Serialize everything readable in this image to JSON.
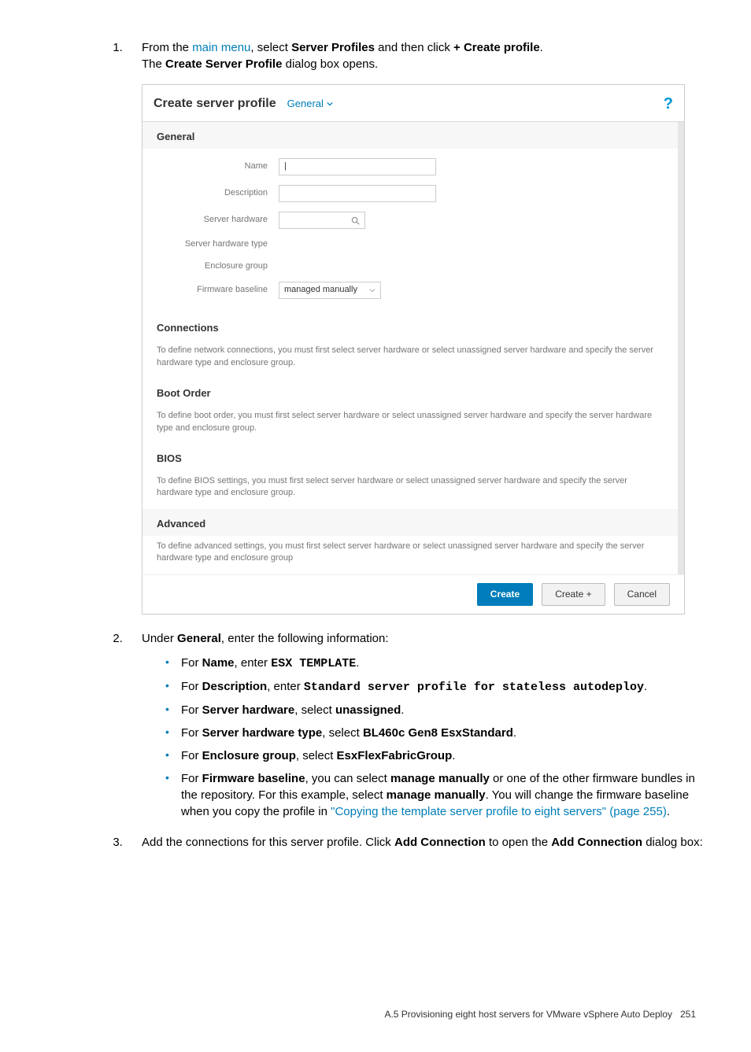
{
  "step1": {
    "pre": "From the ",
    "link": "main menu",
    "mid1": ", select ",
    "bold1": "Server Profiles",
    "mid2": " and then click ",
    "bold2": "+ Create profile",
    "end": ".",
    "line2_pre": "The ",
    "line2_bold": "Create Server Profile",
    "line2_post": " dialog box opens."
  },
  "dialog": {
    "title": "Create server profile",
    "tab": "General",
    "help": "?",
    "sections": {
      "general": {
        "title": "General",
        "labels": {
          "name": "Name",
          "description": "Description",
          "server_hardware": "Server hardware",
          "server_hardware_type": "Server hardware type",
          "enclosure_group": "Enclosure group",
          "firmware_baseline": "Firmware baseline"
        },
        "firmware_value": "managed manually"
      },
      "connections": {
        "title": "Connections",
        "desc": "To define network connections, you must first select server hardware or select unassigned server hardware and specify the server hardware type and enclosure group."
      },
      "boot": {
        "title": "Boot Order",
        "desc": "To define boot order, you must first select server hardware or select unassigned server hardware and specify the server hardware type and enclosure group."
      },
      "bios": {
        "title": "BIOS",
        "desc": "To define BIOS settings, you must first select server hardware or select unassigned server hardware and specify the server hardware type and enclosure group."
      },
      "advanced": {
        "title": "Advanced",
        "desc": "To define advanced settings, you must first select server hardware or select unassigned server hardware and specify the server hardware type and enclosure group"
      }
    },
    "buttons": {
      "create": "Create",
      "create_plus": "Create +",
      "cancel": "Cancel"
    }
  },
  "step2": {
    "lead_pre": "Under ",
    "lead_bold": "General",
    "lead_post": ", enter the following information:",
    "bullets": {
      "b1": {
        "p1": "For ",
        "b1": "Name",
        "p2": ", enter ",
        "m1": "ESX TEMPLATE",
        "p3": "."
      },
      "b2": {
        "p1": "For ",
        "b1": "Description",
        "p2": ", enter ",
        "m1": "Standard server profile for stateless autodeploy",
        "p3": "."
      },
      "b3": {
        "p1": "For ",
        "b1": "Server hardware",
        "p2": ", select ",
        "b2": "unassigned",
        "p3": "."
      },
      "b4": {
        "p1": "For ",
        "b1": "Server hardware type",
        "p2": ", select ",
        "b2": "BL460c Gen8 EsxStandard",
        "p3": "."
      },
      "b5": {
        "p1": "For ",
        "b1": "Enclosure group",
        "p2": ", select ",
        "b2": "EsxFlexFabricGroup",
        "p3": "."
      },
      "b6": {
        "p1": "For ",
        "b1": "Firmware baseline",
        "p2": ", you can select ",
        "b2": "manage manually",
        "p3": " or one of the other firmware bundles in the repository. For this example, select ",
        "b3": "manage manually",
        "p4": ". You will change the firmware baseline when you copy the profile in ",
        "link": "\"Copying the template server profile to eight servers\" (page 255)",
        "p5": "."
      }
    }
  },
  "step3": {
    "p1": "Add the connections for this server profile. Click ",
    "b1": "Add Connection",
    "p2": " to open the ",
    "b2": "Add Connection",
    "p3": " dialog box:"
  },
  "footer": {
    "text": "A.5 Provisioning eight host servers for VMware vSphere Auto Deploy",
    "page": "251"
  }
}
